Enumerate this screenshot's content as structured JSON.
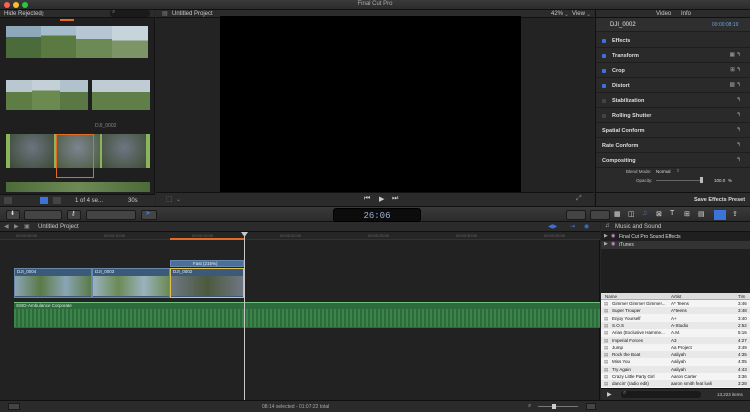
{
  "app": {
    "title": "Final Cut Pro"
  },
  "browser": {
    "filter": "Hide Rejected",
    "clip_label": "DJI_0002",
    "footer_count": "1 of 4 se...",
    "footer_duration": "30s"
  },
  "viewer": {
    "project": "Untitled Project",
    "zoom": "42%",
    "view_menu": "View"
  },
  "inspector": {
    "tab_video": "Video",
    "tab_info": "Info",
    "clip_name": "DJI_0002",
    "clip_time": "00:00:08:19",
    "rows": [
      "Effects",
      "Transform",
      "Crop",
      "Distort",
      "Stabilization",
      "Rolling Shutter",
      "Spatial Conform",
      "Rate Conform",
      "Compositing"
    ],
    "blend_label": "Blend Mode:",
    "blend_value": "Normal",
    "opacity_label": "Opacity:",
    "opacity_value": "100.0",
    "opacity_unit": "%",
    "save_preset": "Save Effects Preset"
  },
  "toolbar": {
    "timecode": "26:06"
  },
  "timeline": {
    "project": "Untitled Project",
    "ruler": [
      "00:00:05:00",
      "00:00:10:00",
      "00:00:15:00",
      "00:00:20:00",
      "00:00:25:00",
      "00:00:30:00",
      "00:00:35:00",
      "00:00:40:00",
      "00:00:45:00",
      "00:00:50:00"
    ],
    "clip1": "DJI_0004",
    "clip2": "DJI_0003",
    "clip3": "DJI_0002",
    "connected": "Fast (215%)",
    "audio": "SSID-Ambulance Corporate",
    "status": "08:14 selected - 01:07:22 total"
  },
  "media": {
    "title": "Music and Sound",
    "item1": "Final Cut Pro Sound Effects",
    "item2": "iTunes",
    "col_name": "Name",
    "col_artist": "Artist",
    "col_time": "Tim",
    "tracks": [
      {
        "name": "Gimme! Gimme! Gimme!...",
        "artist": "A* Teens",
        "time": "3:46"
      },
      {
        "name": "Super Trouper",
        "artist": "A*teens",
        "time": "3:48"
      },
      {
        "name": "Enjoy Yourself",
        "artist": "A+",
        "time": "3:40"
      },
      {
        "name": "S.O.S",
        "artist": "A-Studio",
        "time": "2:52"
      },
      {
        "name": "Arias (Exclusive Hamme...",
        "artist": "A.M.",
        "time": "5:16"
      },
      {
        "name": "Imperial Forces",
        "artist": "A3",
        "time": "4:27"
      },
      {
        "name": "Jump",
        "artist": "Aa Project",
        "time": "3:49"
      },
      {
        "name": "Rock the Boat",
        "artist": "Aaliyah",
        "time": "4:35"
      },
      {
        "name": "Miss You",
        "artist": "Aaliyah",
        "time": "4:05"
      },
      {
        "name": "Try Again",
        "artist": "Aaliyah",
        "time": "4:43"
      },
      {
        "name": "Crazy Little Party Girl",
        "artist": "Aaron Carter",
        "time": "3:36"
      },
      {
        "name": "dancin' (radio edit)",
        "artist": "aaron smith feat luvli",
        "time": "3:28"
      }
    ],
    "count": "13,223 items"
  },
  "colors": {
    "accent": "#3b73d9",
    "clip": "#3b5a7a",
    "audio": "#2d6b3c"
  }
}
